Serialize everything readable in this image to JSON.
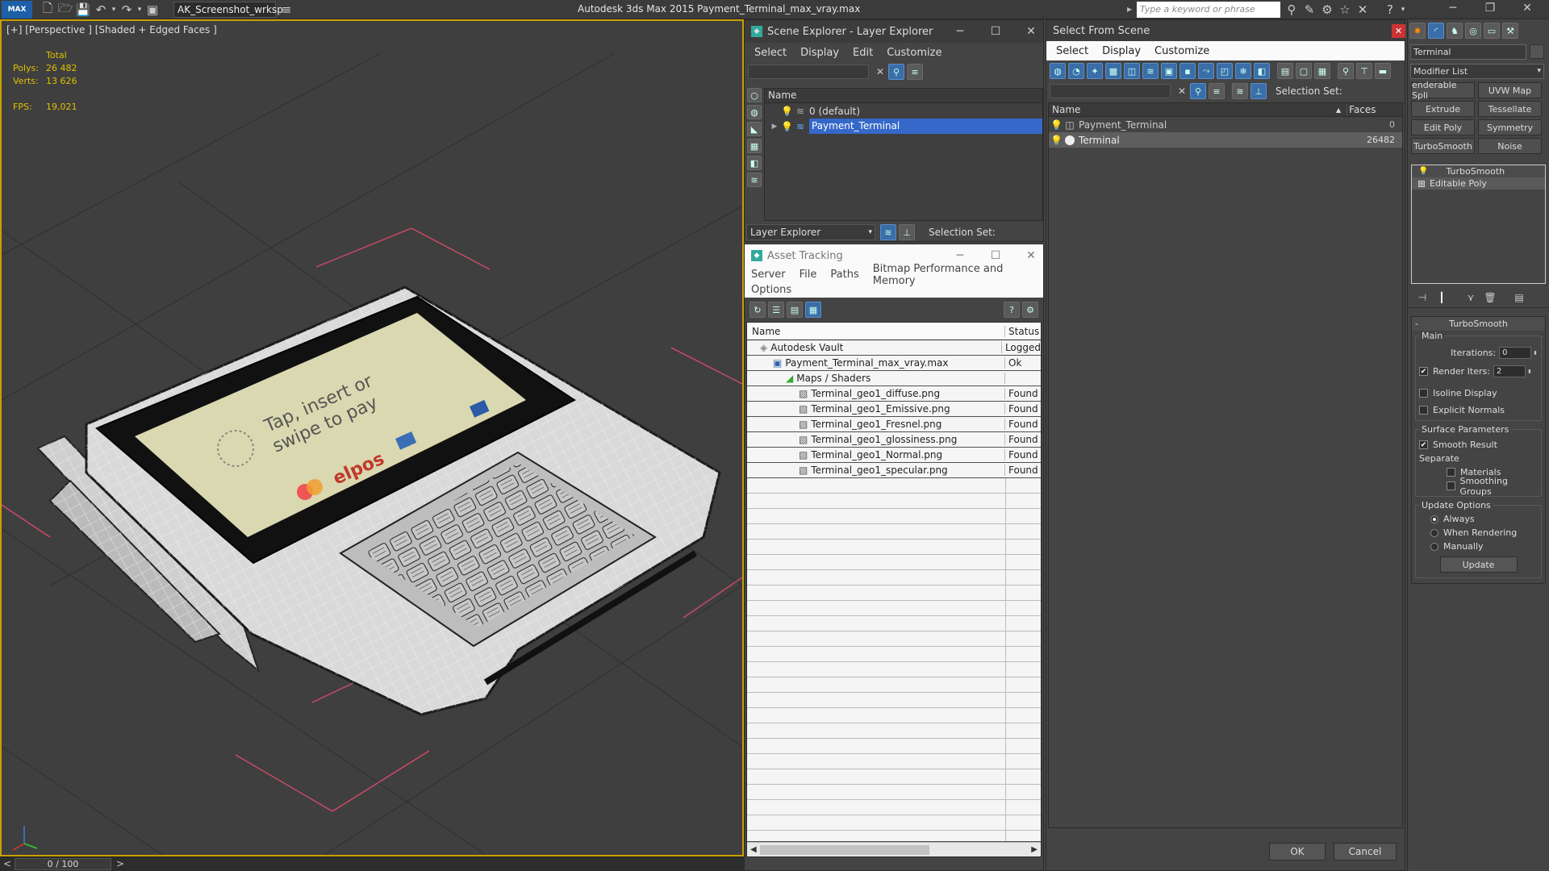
{
  "titlebar": {
    "app_badge": "MAX",
    "workspace": "AK_Screenshot_wrksp",
    "title": "Autodesk 3ds Max  2015     Payment_Terminal_max_vray.max",
    "keyword_placeholder": "Type a keyword or phrase"
  },
  "viewport": {
    "label": "[+] [Perspective ] [Shaded + Edged Faces ]",
    "stats": {
      "total_label": "Total",
      "polys_label": "Polys:",
      "polys_value": "26 482",
      "verts_label": "Verts:",
      "verts_value": "13 626",
      "fps_label": "FPS:",
      "fps_value": "19,021"
    },
    "screen": {
      "line1": "Tap, insert or",
      "line2": "swipe to pay",
      "brand": "elpos"
    }
  },
  "timeline": {
    "value": "0 / 100",
    "prev": "<",
    "next": ">"
  },
  "scene_explorer": {
    "title": "Scene Explorer - Layer Explorer",
    "menu": [
      "Select",
      "Display",
      "Edit",
      "Customize"
    ],
    "column": "Name",
    "rows": [
      "0 (default)",
      "Payment_Terminal"
    ],
    "footer_label": "Layer Explorer",
    "selection_set": "Selection Set:"
  },
  "asset_tracking": {
    "title": "Asset Tracking",
    "menu": [
      "Server",
      "File",
      "Paths",
      "Bitmap Performance and Memory"
    ],
    "menu2": "Options",
    "columns": [
      "Name",
      "Status"
    ],
    "rows": [
      {
        "name": "Autodesk Vault",
        "status": "Logged"
      },
      {
        "name": "Payment_Terminal_max_vray.max",
        "status": "Ok"
      },
      {
        "name": "Maps / Shaders",
        "status": ""
      },
      {
        "name": "Terminal_geo1_diffuse.png",
        "status": "Found"
      },
      {
        "name": "Terminal_geo1_Emissive.png",
        "status": "Found"
      },
      {
        "name": "Terminal_geo1_Fresnel.png",
        "status": "Found"
      },
      {
        "name": "Terminal_geo1_glossiness.png",
        "status": "Found"
      },
      {
        "name": "Terminal_geo1_Normal.png",
        "status": "Found"
      },
      {
        "name": "Terminal_geo1_specular.png",
        "status": "Found"
      }
    ]
  },
  "select_from_scene": {
    "title": "Select From Scene",
    "menu": [
      "Select",
      "Display",
      "Customize"
    ],
    "selection_set": "Selection Set:",
    "columns": [
      "Name",
      "Faces"
    ],
    "rows": [
      {
        "name": "Payment_Terminal",
        "faces": "0"
      },
      {
        "name": "Terminal",
        "faces": "26482"
      }
    ],
    "ok": "OK",
    "cancel": "Cancel"
  },
  "command_panel": {
    "object_name": "Terminal",
    "modifier_list": "Modifier List",
    "buttons": [
      [
        "enderable Spli",
        "UVW Map"
      ],
      [
        "Extrude",
        "Tessellate"
      ],
      [
        "Edit Poly",
        "Symmetry"
      ],
      [
        "TurboSmooth",
        "Noise"
      ]
    ],
    "stack": [
      "TurboSmooth",
      "Editable Poly"
    ],
    "rollout_title": "TurboSmooth",
    "main_label": "Main",
    "iterations_label": "Iterations:",
    "iterations_value": "0",
    "render_iters_label": "Render Iters:",
    "render_iters_value": "2",
    "isoline": "Isoline Display",
    "explicit": "Explicit Normals",
    "surface_label": "Surface Parameters",
    "smooth_result": "Smooth Result",
    "separate_label": "Separate",
    "materials": "Materials",
    "smoothing_groups": "Smoothing Groups",
    "update_label": "Update Options",
    "always": "Always",
    "when_rendering": "When Rendering",
    "manually": "Manually",
    "update_button": "Update"
  },
  "colors": {
    "selection": "#3668c9",
    "stats": "#e0c000",
    "viewport_border": "#c8a000"
  }
}
